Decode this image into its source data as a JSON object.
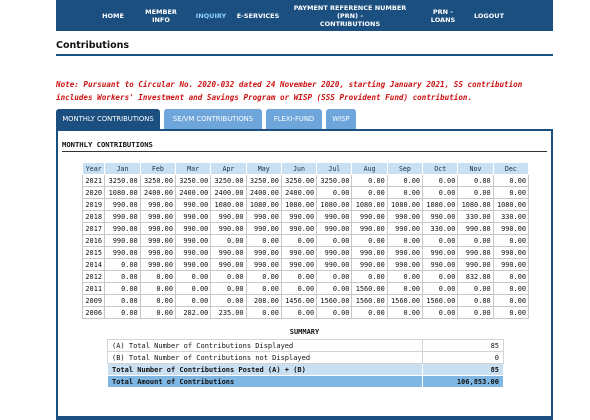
{
  "nav": {
    "items": [
      {
        "label": "HOME"
      },
      {
        "label": "MEMBER INFO"
      },
      {
        "label": "INQUIRY"
      },
      {
        "label": "E-SERVICES"
      },
      {
        "label_line1": "PAYMENT REFERENCE NUMBER (PRN) -",
        "label_line2": "CONTRIBUTIONS"
      },
      {
        "label": "PRN - LOANS"
      },
      {
        "label": "LOGOUT"
      }
    ],
    "active": "INQUIRY"
  },
  "page": {
    "title": "Contributions"
  },
  "note": "Note: Pursuant to Circular No. 2020-032 dated 24 November 2020, starting January 2021, SS contribution includes Workers' Investment and Savings Program or WISP (SSS Provident Fund) contribution.",
  "tabs": [
    {
      "label": "MONTHLY CONTRIBUTIONS"
    },
    {
      "label": "SE/VM CONTRIBUTIONS"
    },
    {
      "label": "FLEXI-FUND"
    },
    {
      "label": "WISP"
    }
  ],
  "active_tab": "MONTHLY CONTRIBUTIONS",
  "section_title": "MONTHLY CONTRIBUTIONS",
  "table": {
    "headers": [
      "Year",
      "Jan",
      "Feb",
      "Mar",
      "Apr",
      "May",
      "Jun",
      "Jul",
      "Aug",
      "Sep",
      "Oct",
      "Nov",
      "Dec"
    ],
    "rows": [
      [
        "2021",
        "3250.00",
        "3250.00",
        "3250.00",
        "3250.00",
        "3250.00",
        "3250.00",
        "3250.00",
        "0.00",
        "0.00",
        "0.00",
        "0.00",
        "0.00"
      ],
      [
        "2020",
        "1080.00",
        "2400.00",
        "2400.00",
        "2400.00",
        "2400.00",
        "2400.00",
        "0.00",
        "0.00",
        "0.00",
        "0.00",
        "0.00",
        "0.00"
      ],
      [
        "2019",
        "990.00",
        "990.00",
        "990.00",
        "1080.00",
        "1080.00",
        "1080.00",
        "1080.00",
        "1080.00",
        "1080.00",
        "1080.00",
        "1080.00",
        "1080.00"
      ],
      [
        "2018",
        "990.00",
        "990.00",
        "990.00",
        "990.00",
        "990.00",
        "990.00",
        "990.00",
        "990.00",
        "990.00",
        "990.00",
        "330.00",
        "330.00"
      ],
      [
        "2017",
        "990.00",
        "990.00",
        "990.00",
        "990.00",
        "990.00",
        "990.00",
        "990.00",
        "990.00",
        "990.00",
        "330.00",
        "990.00",
        "990.00"
      ],
      [
        "2016",
        "990.00",
        "990.00",
        "990.00",
        "0.00",
        "0.00",
        "0.00",
        "0.00",
        "0.00",
        "0.00",
        "0.00",
        "0.00",
        "0.00"
      ],
      [
        "2015",
        "990.00",
        "990.00",
        "990.00",
        "990.00",
        "990.00",
        "990.00",
        "990.00",
        "990.00",
        "990.00",
        "990.00",
        "990.00",
        "990.00"
      ],
      [
        "2014",
        "0.00",
        "990.00",
        "990.00",
        "990.00",
        "990.00",
        "990.00",
        "990.00",
        "990.00",
        "990.00",
        "990.00",
        "990.00",
        "990.00"
      ],
      [
        "2012",
        "0.00",
        "0.00",
        "0.00",
        "0.00",
        "0.00",
        "0.00",
        "0.00",
        "0.00",
        "0.00",
        "0.00",
        "832.00",
        "0.00"
      ],
      [
        "2011",
        "0.00",
        "0.00",
        "0.00",
        "0.00",
        "0.00",
        "0.00",
        "0.00",
        "1560.00",
        "0.00",
        "0.00",
        "0.00",
        "0.00"
      ],
      [
        "2009",
        "0.00",
        "0.00",
        "0.00",
        "0.00",
        "208.00",
        "1456.00",
        "1560.00",
        "1560.00",
        "1560.00",
        "1560.00",
        "0.00",
        "0.00"
      ],
      [
        "2006",
        "0.00",
        "0.00",
        "282.00",
        "235.00",
        "0.00",
        "0.00",
        "0.00",
        "0.00",
        "0.00",
        "0.00",
        "0.00",
        "0.00"
      ]
    ]
  },
  "summary": {
    "title": "SUMMARY",
    "rows": [
      {
        "label": "(A) Total Number of Contributions Displayed",
        "value": "85"
      },
      {
        "label": "(B) Total Number of Contributions not Displayed",
        "value": "0"
      },
      {
        "label": "Total Number of Contributions Posted (A) + (B)",
        "value": "85"
      },
      {
        "label": "Total Amount of Contributions",
        "value": "106,853.00"
      }
    ]
  },
  "colors": {
    "nav_bg": "#1a4f7f",
    "nav_active": "#8fd0ff",
    "note_red": "#cc1111",
    "tab_inactive": "#6ea6db",
    "header_row": "#c9dff2",
    "summary_total": "#7fb7e2"
  }
}
